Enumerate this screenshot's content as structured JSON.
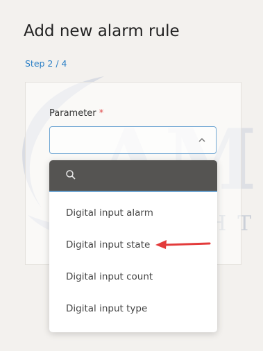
{
  "watermark": {
    "text": "AM",
    "subtext": "YACHT"
  },
  "header": {
    "title": "Add new alarm rule",
    "step": "Step 2 / 4"
  },
  "form": {
    "parameter_label": "Parameter",
    "required_marker": "*",
    "selected_value": "",
    "search_placeholder": ""
  },
  "dropdown": {
    "options": [
      {
        "label": "Digital input alarm"
      },
      {
        "label": "Digital input state"
      },
      {
        "label": "Digital input count"
      },
      {
        "label": "Digital input type"
      }
    ]
  },
  "colors": {
    "accent": "#2a7fc6",
    "required": "#e04b4b",
    "search_bg": "#555452",
    "annotation_arrow": "#e33b3b"
  },
  "icons": {
    "chevron": "chevron-up-icon",
    "search": "search-icon",
    "annotation": "red-arrow-icon"
  }
}
